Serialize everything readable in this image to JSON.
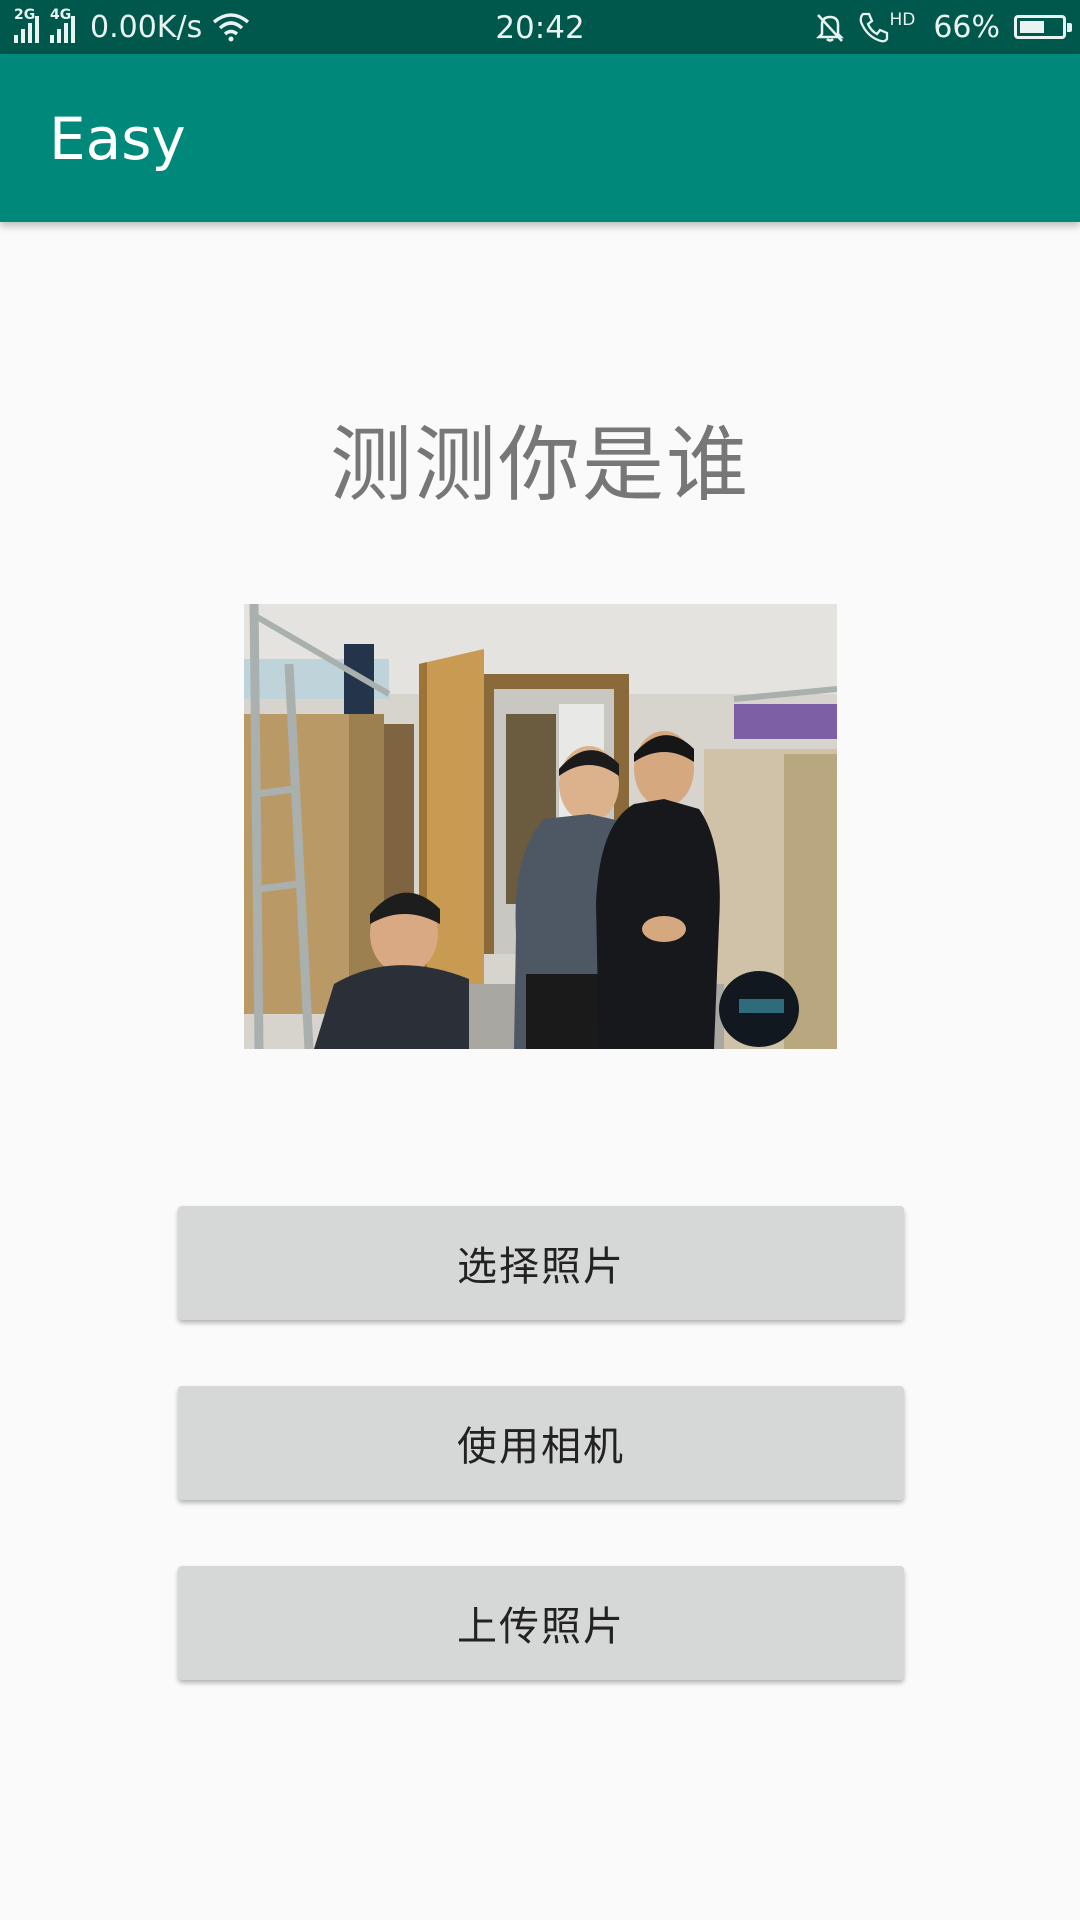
{
  "status_bar": {
    "network_1": "2G",
    "network_2": "4G",
    "speed": "0.00K/s",
    "time": "20:42",
    "call_badge": "HD",
    "battery": "66%",
    "battery_level": 0.66
  },
  "app_bar": {
    "title": "Easy"
  },
  "main": {
    "heading": "测测你是谁",
    "photo_icon": "photo-preview",
    "buttons": [
      {
        "label": "选择照片"
      },
      {
        "label": "使用相机"
      },
      {
        "label": "上传照片"
      }
    ]
  },
  "colors": {
    "status_bar": "#00574b",
    "app_bar": "#00897b",
    "button": "#d6d7d7",
    "background": "#fafafa"
  }
}
